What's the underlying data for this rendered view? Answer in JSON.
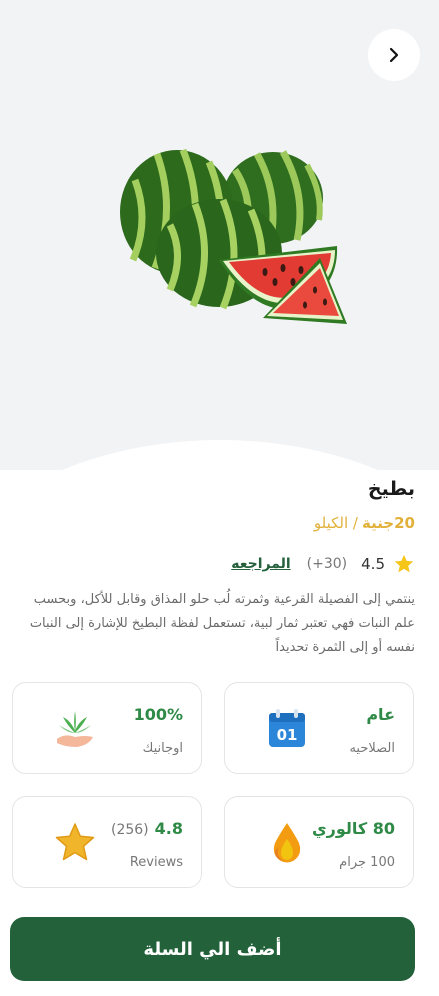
{
  "nav": {
    "forward_icon": "chevron-right-icon"
  },
  "product": {
    "name": "بطيخ",
    "price": "20جنية",
    "unit": "/ الكيلو",
    "image_icon": "watermelon-image",
    "rating": "4.5",
    "rating_count": "(+30)",
    "reviews_link": "المراجعه",
    "description": "ينتمي إلى الفصيلة القرعية وثمرته لُب حلو المذاق وقابل للأكل، وبحسب علم النبات فهي تعتبر ثمار لبية، تستعمل لفظة البطيخ للإشارة إلى النبات نفسه أو إلى الثمرة تحديداً"
  },
  "cards": {
    "validity": {
      "value": "عام",
      "label": "الصلاحيه",
      "icon": "calendar-icon",
      "icon_text": "01"
    },
    "organic": {
      "value": "100%",
      "label": "اوجانيك",
      "icon": "plant-hand-icon"
    },
    "calories": {
      "value": "80 كالوري",
      "label": "100 جرام",
      "icon": "flame-icon"
    },
    "reviews": {
      "value": "4.8",
      "count": "(256)",
      "label": "Reviews",
      "icon": "star-icon"
    }
  },
  "actions": {
    "add_to_cart": "أضف الي السلة"
  },
  "colors": {
    "primary": "#22613a",
    "accent_green": "#2f8a47",
    "price_gold": "#e2b13b",
    "hero_bg": "#f2f3f5"
  }
}
